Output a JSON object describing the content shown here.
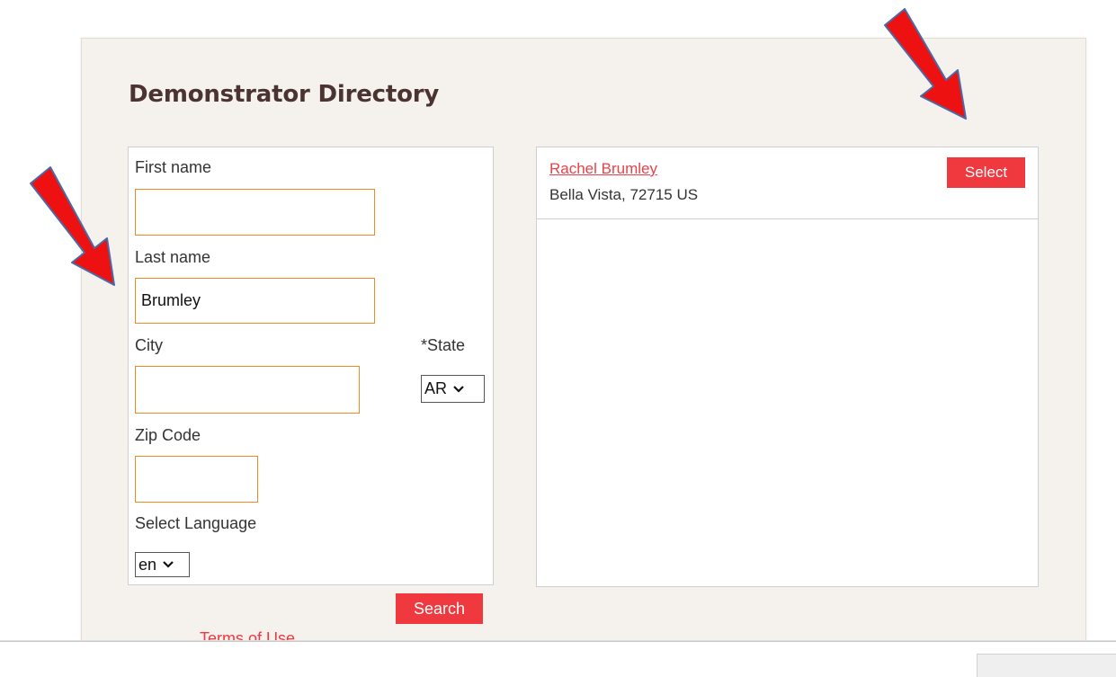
{
  "page": {
    "title": "Demonstrator Directory"
  },
  "form": {
    "first_name": {
      "label": "First name",
      "value": ""
    },
    "last_name": {
      "label": "Last name",
      "value": "Brumley"
    },
    "city": {
      "label": "City",
      "value": ""
    },
    "state": {
      "label": "*State",
      "selected": "AR"
    },
    "zip": {
      "label": "Zip Code",
      "value": ""
    },
    "language": {
      "label": "Select Language",
      "selected": "en"
    },
    "search_label": "Search"
  },
  "results": [
    {
      "name": "Rachel Brumley",
      "address": "Bella Vista, 72715 US",
      "select_label": "Select"
    }
  ],
  "footer": {
    "terms_label": "Terms of Use"
  },
  "colors": {
    "accent": "#f0383f",
    "input_border": "#f08a24",
    "title": "#4a3330",
    "annotation_arrow": "#ee1111"
  },
  "annotations": {
    "arrow_icon": "red-arrow-icon"
  }
}
